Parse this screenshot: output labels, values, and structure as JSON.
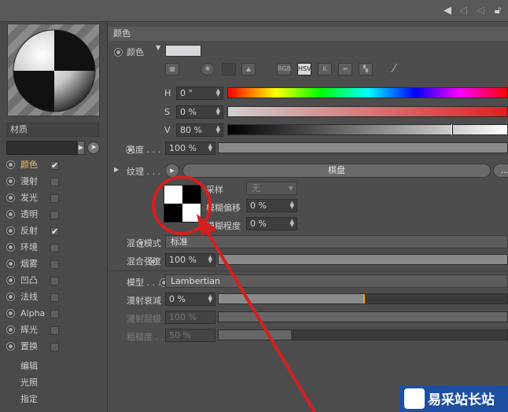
{
  "left": {
    "material_label": "材质",
    "channels": [
      {
        "label": "颜色",
        "checked": true,
        "active": true
      },
      {
        "label": "漫射",
        "checked": false
      },
      {
        "label": "发光",
        "checked": false
      },
      {
        "label": "透明",
        "checked": false
      },
      {
        "label": "反射",
        "checked": true
      },
      {
        "label": "环境",
        "checked": false
      },
      {
        "label": "烟雾",
        "checked": false
      },
      {
        "label": "凹凸",
        "checked": false
      },
      {
        "label": "法线",
        "checked": false
      },
      {
        "label": "Alpha",
        "checked": false
      },
      {
        "label": "辉光",
        "checked": false
      },
      {
        "label": "置换",
        "checked": false
      }
    ],
    "extras": [
      "编辑",
      "光照",
      "指定"
    ]
  },
  "section": {
    "title": "颜色"
  },
  "color": {
    "label": "颜色",
    "swatch": "#d8d8dc",
    "modes": [
      "RGB",
      "HSV",
      "K"
    ],
    "selected_mode": "HSV",
    "h_label": "H",
    "h_value": "0 °",
    "s_label": "S",
    "s_value": "0 %",
    "v_label": "V",
    "v_value": "80 %",
    "v_level": 0.8
  },
  "brightness": {
    "label": "亮度 . . .",
    "value": "100 %",
    "level": 1.0
  },
  "texture": {
    "label": "纹理 . . .",
    "button": "棋盘",
    "more": "...",
    "sampling_label": "采样",
    "sampling_value": "无",
    "blur_offset_label": "模糊偏移",
    "blur_offset_value": "0 %",
    "blur_degree_label": "模糊程度",
    "blur_degree_value": "0 %"
  },
  "blend": {
    "mode_label": "混合模式",
    "mode_value": "标准",
    "strength_label": "混合强度",
    "strength_value": "100 %",
    "strength_level": 1.0
  },
  "model": {
    "label": "模型 . . .",
    "value": "Lambertian",
    "diffuse_falloff_label": "漫射衰减",
    "diffuse_falloff_value": "0 %",
    "diffuse_falloff_level": 0.5,
    "diffuse_level_label": "漫射层级",
    "diffuse_level_value": "100 %",
    "roughness_label": "粗糙度 . . .",
    "roughness_value": "50 %",
    "roughness_level": 0.25
  },
  "colors": {
    "accent": "#f0c060",
    "annotation": "#d42020"
  },
  "watermark": {
    "text": "易采站长站"
  }
}
